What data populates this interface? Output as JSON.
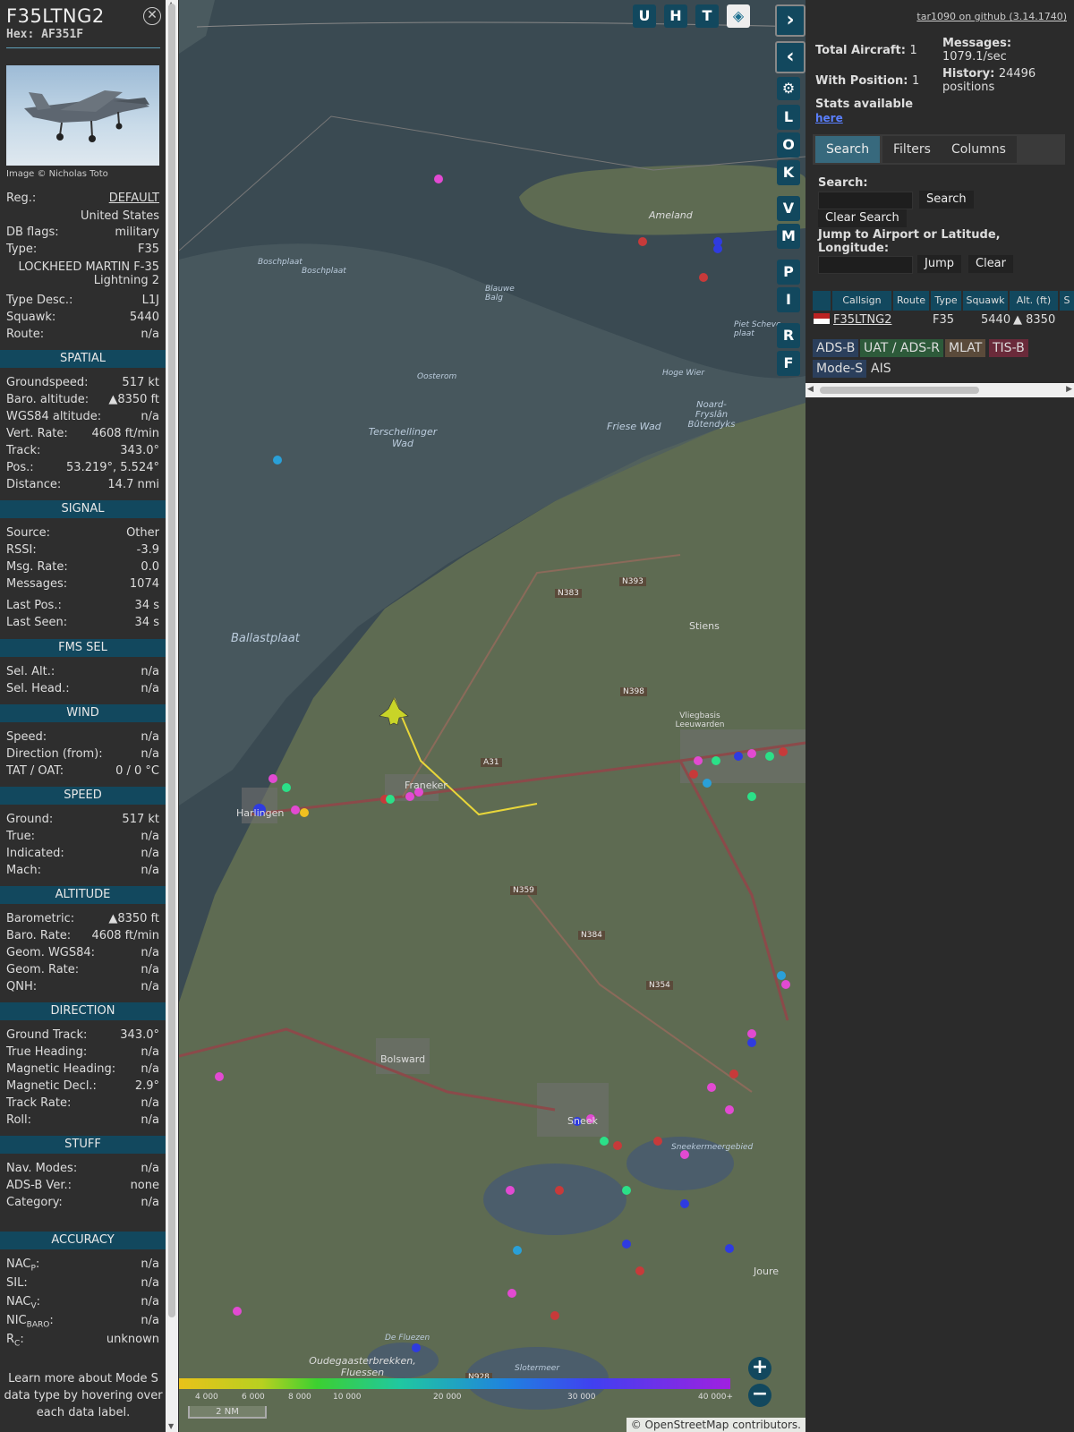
{
  "aircraft": {
    "callsign": "F35LTNG2",
    "hex": "Hex: AF351F",
    "photo_credit": "Image © Nicholas Toto",
    "reg_label": "Reg.:",
    "reg_value": "DEFAULT",
    "country": "United States",
    "dbflags_label": "DB flags:",
    "dbflags_value": "military",
    "type_label": "Type:",
    "type_value": "F35",
    "model_line1": "LOCKHEED MARTIN F-35",
    "model_line2": "Lightning 2",
    "typedesc_label": "Type Desc.:",
    "typedesc_value": "L1J",
    "squawk_label": "Squawk:",
    "squawk_value": "5440",
    "route_label": "Route:",
    "route_value": "n/a"
  },
  "sections": {
    "spatial": "SPATIAL",
    "signal": "SIGNAL",
    "fms": "FMS SEL",
    "wind": "WIND",
    "speed": "SPEED",
    "altitude": "ALTITUDE",
    "direction": "DIRECTION",
    "stuff": "STUFF",
    "accuracy": "ACCURACY"
  },
  "spatial": [
    {
      "k": "Groundspeed:",
      "v": "517 kt"
    },
    {
      "k": "Baro. altitude:",
      "v": "▲8350 ft"
    },
    {
      "k": "WGS84 altitude:",
      "v": "n/a"
    },
    {
      "k": "Vert. Rate:",
      "v": "4608 ft/min"
    },
    {
      "k": "Track:",
      "v": "343.0°"
    },
    {
      "k": "Pos.:",
      "v": "53.219°, 5.524°"
    },
    {
      "k": "Distance:",
      "v": "14.7 nmi"
    }
  ],
  "signal": [
    {
      "k": "Source:",
      "v": "Other"
    },
    {
      "k": "RSSI:",
      "v": "-3.9"
    },
    {
      "k": "Msg. Rate:",
      "v": "0.0"
    },
    {
      "k": "Messages:",
      "v": "1074"
    },
    {
      "k": "Last Pos.:",
      "v": "34 s"
    },
    {
      "k": "Last Seen:",
      "v": "34 s"
    }
  ],
  "fms": [
    {
      "k": "Sel. Alt.:",
      "v": "n/a"
    },
    {
      "k": "Sel. Head.:",
      "v": "n/a"
    }
  ],
  "wind": [
    {
      "k": "Speed:",
      "v": "n/a"
    },
    {
      "k": "Direction (from):",
      "v": "n/a"
    },
    {
      "k": "TAT / OAT:",
      "v": "0 / 0 °C"
    }
  ],
  "speed": [
    {
      "k": "Ground:",
      "v": "517 kt"
    },
    {
      "k": "True:",
      "v": "n/a"
    },
    {
      "k": "Indicated:",
      "v": "n/a"
    },
    {
      "k": "Mach:",
      "v": "n/a"
    }
  ],
  "altitude": [
    {
      "k": "Barometric:",
      "v": "▲8350 ft"
    },
    {
      "k": "Baro. Rate:",
      "v": "4608 ft/min"
    },
    {
      "k": "Geom. WGS84:",
      "v": "n/a"
    },
    {
      "k": "Geom. Rate:",
      "v": "n/a"
    },
    {
      "k": "QNH:",
      "v": "n/a"
    }
  ],
  "direction": [
    {
      "k": "Ground Track:",
      "v": "343.0°"
    },
    {
      "k": "True Heading:",
      "v": "n/a"
    },
    {
      "k": "Magnetic Heading:",
      "v": "n/a"
    },
    {
      "k": "Magnetic Decl.:",
      "v": "2.9°"
    },
    {
      "k": "Track Rate:",
      "v": "n/a"
    },
    {
      "k": "Roll:",
      "v": "n/a"
    }
  ],
  "stuff": [
    {
      "k": "Nav. Modes:",
      "v": "n/a"
    },
    {
      "k": "ADS-B Ver.:",
      "v": "none"
    },
    {
      "k": "Category:",
      "v": "n/a"
    }
  ],
  "accuracy": [
    {
      "k": "NAC",
      "sub": "P",
      "v": "n/a"
    },
    {
      "k": "SIL:",
      "sub": "",
      "v": "n/a"
    },
    {
      "k": "NAC",
      "sub": "V",
      "v": "n/a"
    },
    {
      "k": "NIC",
      "sub": "BARO",
      "v": "n/a"
    },
    {
      "k": "R",
      "sub": "C",
      "v": "unknown"
    }
  ],
  "learn_more": "Learn more about Mode S data type by hovering over each data label.",
  "map": {
    "top_buttons": [
      "U",
      "H",
      "T"
    ],
    "side_buttons": [
      "L",
      "O",
      "K",
      "V",
      "M",
      "P",
      "I",
      "R",
      "F"
    ],
    "scale": "2 NM",
    "attribution": "© OpenStreetMap contributors.",
    "alt_labels": [
      "4 000",
      "6 000",
      "8 000",
      "10 000",
      "20 000",
      "30 000",
      "40 000+"
    ],
    "places": [
      {
        "name": "Ameland"
      },
      {
        "name": "Boschplaat"
      },
      {
        "name": "Boschplaat"
      },
      {
        "name": "Blauwe Balg"
      },
      {
        "name": "Oosterom"
      },
      {
        "name": "Terschellinger Wad"
      },
      {
        "name": "Friese Wad"
      },
      {
        "name": "Hoge Wier"
      },
      {
        "name": "Noard-Fryslân Bûtendyks"
      },
      {
        "name": "Piet Scheve plaat"
      },
      {
        "name": "Ballastplaat"
      },
      {
        "name": "Stiens"
      },
      {
        "name": "Vliegbasis Leeuwarden"
      },
      {
        "name": "Franeker"
      },
      {
        "name": "Harlingen"
      },
      {
        "name": "Bolsward"
      },
      {
        "name": "Sneek"
      },
      {
        "name": "Sneekermeergebied"
      },
      {
        "name": "Joure"
      },
      {
        "name": "De Fluezen"
      },
      {
        "name": "Oudegaasterbrekken, Fluessen"
      },
      {
        "name": "Slotermeer"
      }
    ],
    "roads": [
      "N383",
      "N393",
      "N398",
      "A31",
      "N359",
      "N384",
      "N354",
      "N928"
    ]
  },
  "right": {
    "github": "tar1090 on github (3.14.1740)",
    "total_aircraft_label": "Total Aircraft:",
    "total_aircraft": "1",
    "with_position_label": "With Position:",
    "with_position": "1",
    "messages_label": "Messages:",
    "messages": "1079.1/sec",
    "history_label": "History:",
    "history": "24496 positions",
    "stats_label": "Stats available",
    "stats_link": "here",
    "tabs": [
      "Search",
      "Filters",
      "Columns"
    ],
    "search_label": "Search:",
    "search_btn": "Search",
    "clear_search": "Clear Search",
    "jump_label": "Jump to Airport or Latitude, Longitude:",
    "jump_btn": "Jump",
    "clear_btn": "Clear",
    "columns": [
      "Callsign",
      "Route",
      "Type",
      "Squawk",
      "Alt. (ft)",
      "S"
    ],
    "row": {
      "callsign": "F35LTNG2",
      "route": "",
      "type": "F35",
      "squawk": "5440",
      "alt": "▲ 8350"
    },
    "legend": [
      {
        "label": "ADS-B",
        "color": "#2b3f5c"
      },
      {
        "label": "UAT / ADS-R",
        "color": "#2d5a3a"
      },
      {
        "label": "MLAT",
        "color": "#5a4a3a"
      },
      {
        "label": "TIS-B",
        "color": "#6a2a3a"
      },
      {
        "label": "Mode-S",
        "color": "#2b3f5c"
      },
      {
        "label": "AIS",
        "color": "#2b2b2b"
      }
    ]
  }
}
